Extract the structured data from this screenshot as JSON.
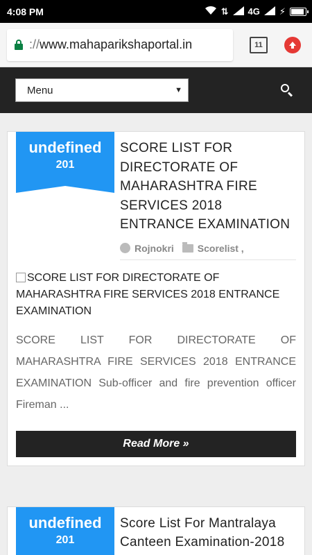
{
  "status_bar": {
    "time": "4:08 PM",
    "network": "4G"
  },
  "browser": {
    "url_scheme": "://",
    "url_host": "www.mahaparikshaportal.in",
    "tab_count": "11"
  },
  "nav": {
    "menu_label": "Menu",
    "menu_caret": "▼"
  },
  "posts": [
    {
      "badge_day": "undefined",
      "badge_year": "201",
      "title": "SCORE LIST FOR DIRECTORATE OF MAHARASHTRA FIRE SERVICES 2018 ENTRANCE EXAMINATION",
      "author": "Rojnokri",
      "category": "Scorelist ,",
      "image_alt": "SCORE LIST FOR DIRECTORATE OF MAHARASHTRA FIRE SERVICES 2018 ENTRANCE EXAMINATION",
      "excerpt": "SCORE LIST FOR DIRECTORATE OF MAHARASHTRA FIRE SERVICES 2018 ENTRANCE EXAMINATION  Sub-officer and fire prevention officer Fireman ...",
      "read_more": "Read More »"
    },
    {
      "badge_day": "undefined",
      "badge_year": "201",
      "title": "Score List For Mantralaya Canteen Examination-2018"
    }
  ],
  "colors": {
    "badge": "#2196f3",
    "nav_bg": "#232323",
    "lock": "#0b8043",
    "upload": "#e53935"
  }
}
